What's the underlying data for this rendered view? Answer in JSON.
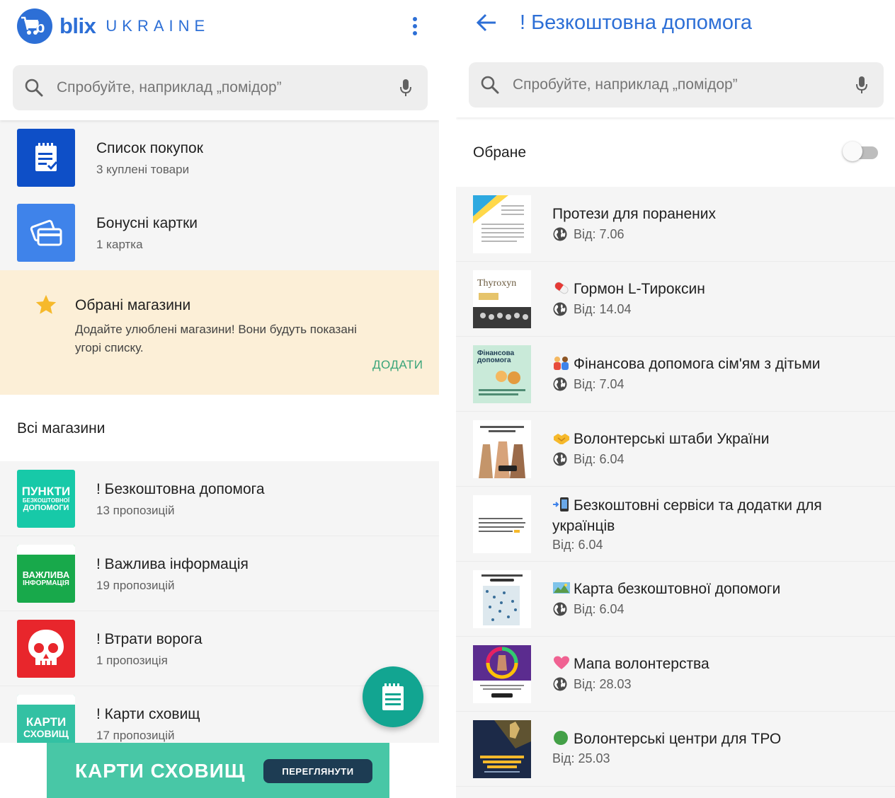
{
  "left": {
    "app": {
      "brand": "blix",
      "country": "UKRAINE"
    },
    "search": {
      "placeholder": "Спробуйте, наприклад „помідор”"
    },
    "menu": [
      {
        "title": "Список покупок",
        "subtitle": "3 куплені товари",
        "icon": "shopping-list-icon",
        "color": "#0e4fc7"
      },
      {
        "title": "Бонусні картки",
        "subtitle": "1 картка",
        "icon": "bonus-card-icon",
        "color": "#3f83ea"
      }
    ],
    "favorites": {
      "title": "Обрані магазини",
      "description": "Додайте улюблені магазини! Вони будуть показані угорі списку.",
      "action": "ДОДАТИ"
    },
    "all_stores_label": "Всі магазини",
    "stores": [
      {
        "title": "! Безкоштовна допомога",
        "subtitle": "13 пропозицій",
        "tile_line1": "ПУНКТИ",
        "tile_line2": "БЕЗКОШТОВНОЇ",
        "tile_line3": "ДОПОМОГИ",
        "color": "#17c9a8"
      },
      {
        "title": "! Важлива інформація",
        "subtitle": "19 пропозицій",
        "tile_line1": "ВАЖЛИВА",
        "tile_line2": "ІНФОРМАЦІЯ",
        "color": "#18a94b"
      },
      {
        "title": "! Втрати ворога",
        "subtitle": "1 пропозиція",
        "icon": "skull-icon",
        "color": "#e8262c"
      },
      {
        "title": "! Карти сховищ",
        "subtitle": "17 пропозицій",
        "tile_line1": "КАРТИ",
        "tile_line2": "СХОВИЩ",
        "color": "#33c1a3"
      }
    ],
    "banner": {
      "title": "КАРТИ СХОВИЩ",
      "button": "ПЕРЕГЛЯНУТИ"
    }
  },
  "right": {
    "title": "! Безкоштовна допомога",
    "search": {
      "placeholder": "Спробуйте, наприклад „помідор”"
    },
    "favorites_toggle": {
      "label": "Обране",
      "on": false
    },
    "offers": [
      {
        "title": "Протези для поранених",
        "date": "Від: 7.06",
        "emoji": "",
        "globe": true
      },
      {
        "title": "Гормон L-Тироксин",
        "date": "Від: 14.04",
        "emoji": "pill-icon",
        "globe": true,
        "thumb_text": "Thyroxyn"
      },
      {
        "title": "Фінансова допомога сім'ям з дітьми",
        "date": "Від: 7.04",
        "emoji": "family-icon",
        "globe": true,
        "thumb_text_1": "Фінансова",
        "thumb_text_2": "допомога"
      },
      {
        "title": "Волонтерські штаби України",
        "date": "Від: 6.04",
        "emoji": "handshake-icon",
        "globe": true
      },
      {
        "title": "Безкоштовні сервіси та додатки для українців",
        "date": "Від: 6.04",
        "emoji": "phone-icon",
        "globe": false
      },
      {
        "title": "Карта безкоштовної допомоги",
        "date": "Від: 6.04",
        "emoji": "map-icon",
        "globe": true
      },
      {
        "title": "Мапа волонтерства",
        "date": "Від: 28.03",
        "emoji": "heart-icon",
        "globe": true
      },
      {
        "title": "Волонтерські центри для ТРО",
        "date": "Від: 25.03",
        "emoji": "green-circle-icon",
        "globe": false
      }
    ]
  }
}
